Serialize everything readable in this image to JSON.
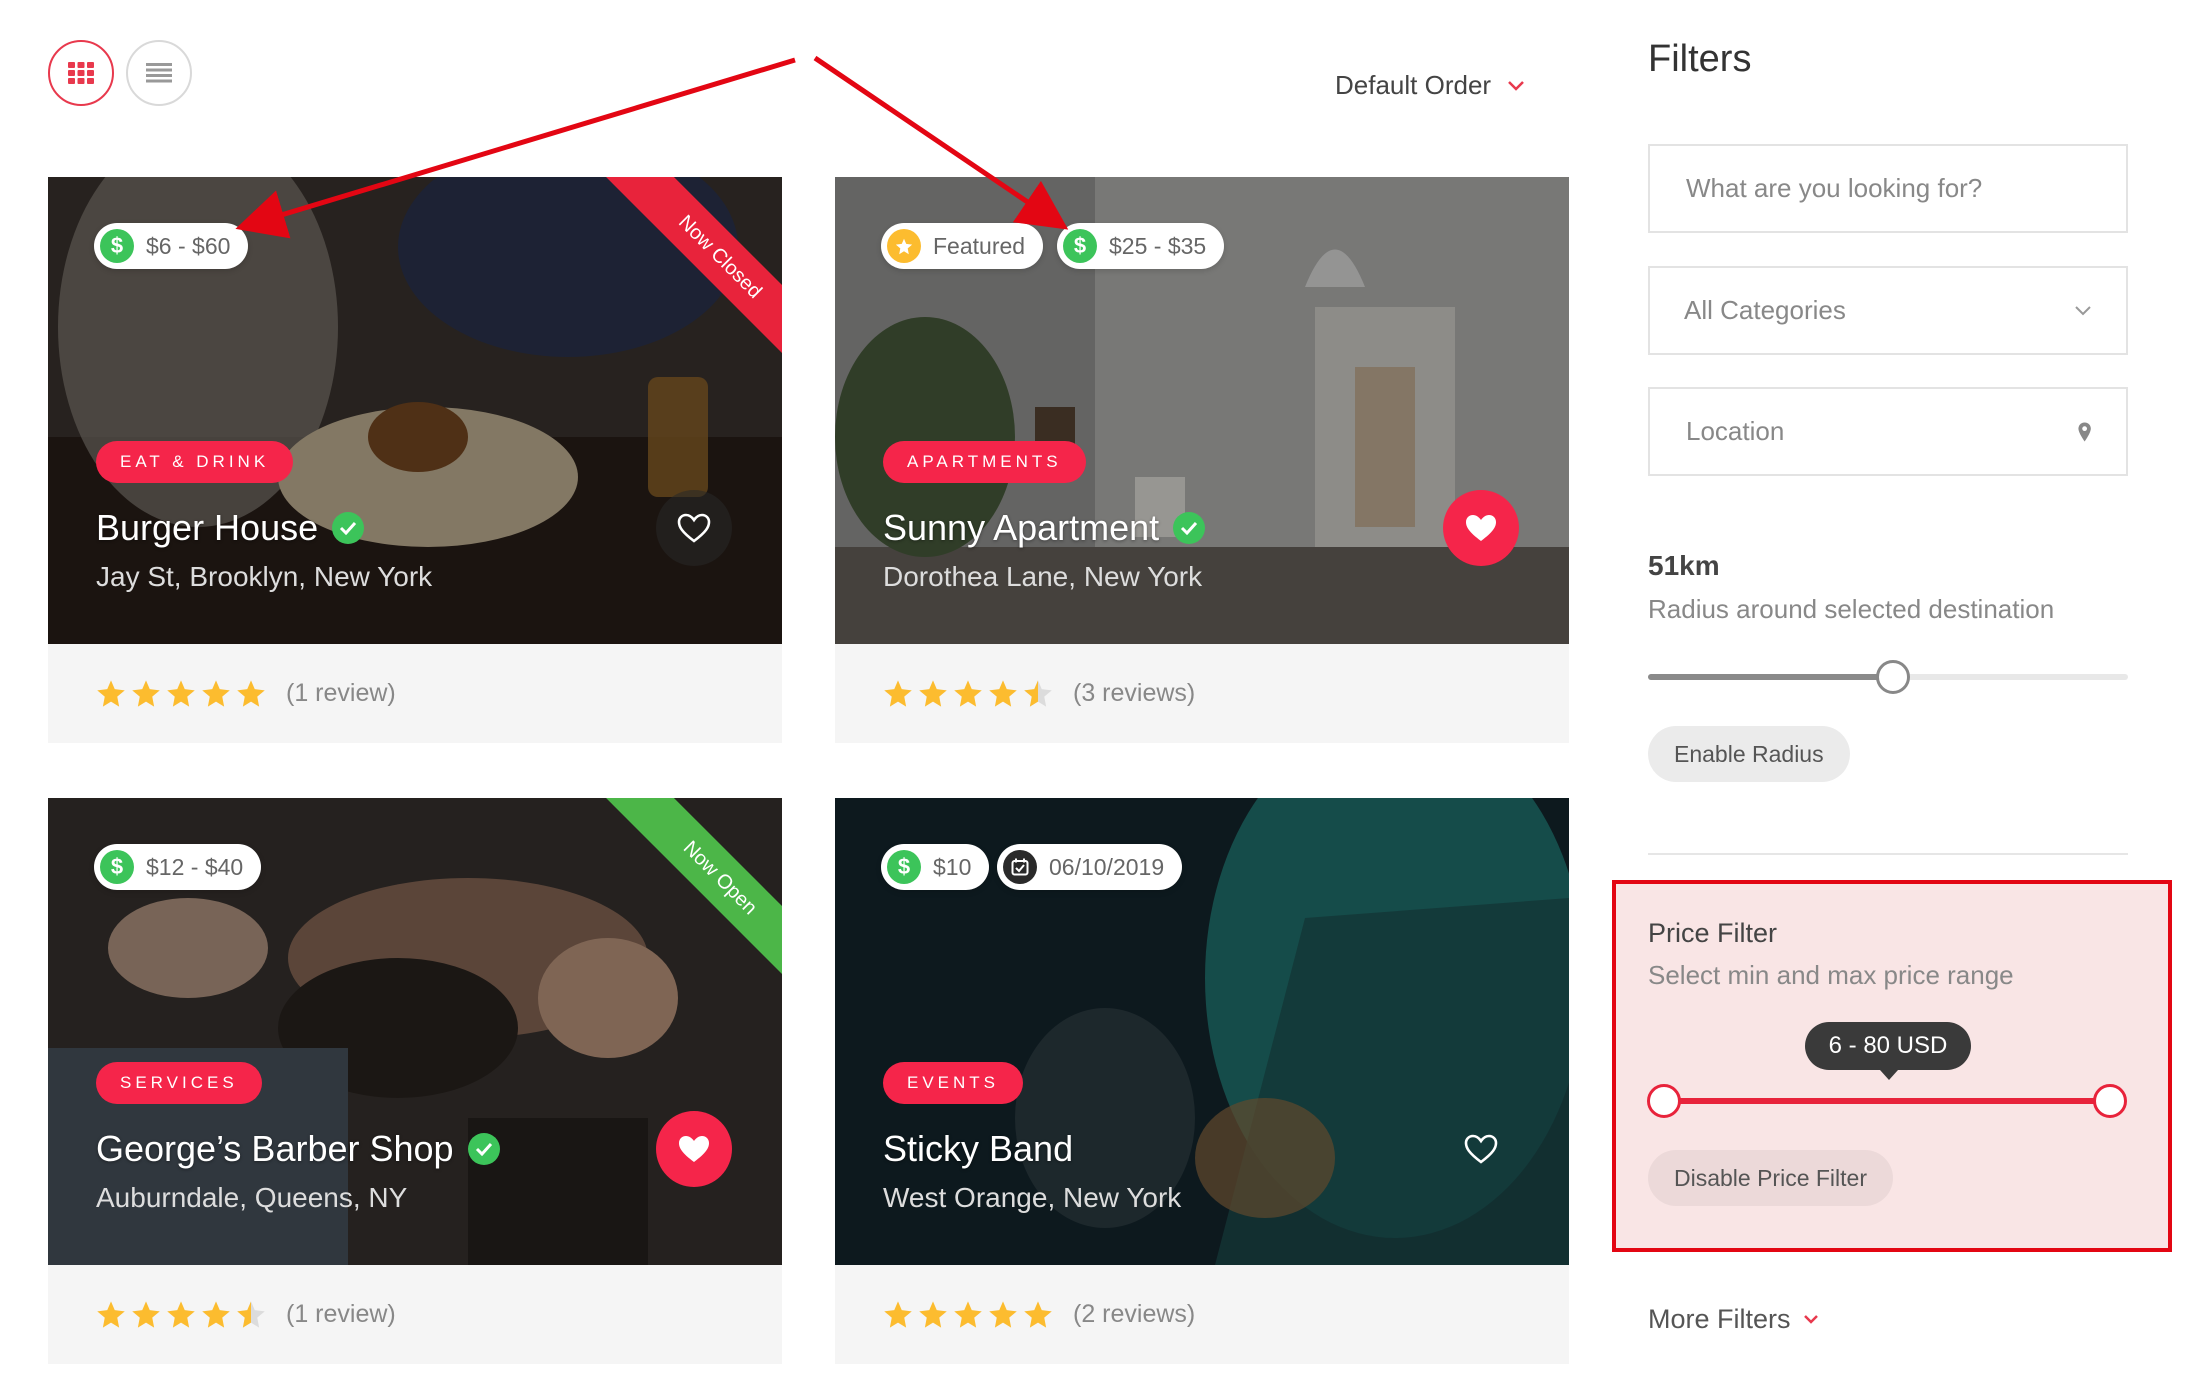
{
  "toolbar": {
    "view_grid_icon": "grid-icon",
    "view_list_icon": "list-icon",
    "sort_label": "Default Order"
  },
  "listings": [
    {
      "price": "$6 - $60",
      "category": "EAT & DRINK",
      "title": "Burger House",
      "address": "Jay St, Brooklyn, New York",
      "ribbon": "Now Closed",
      "ribbon_color": "#e8233b",
      "rating": 5,
      "reviews": "(1 review)",
      "favorite": false
    },
    {
      "featured": "Featured",
      "price": "$25 - $35",
      "category": "APARTMENTS",
      "title": "Sunny Apartment",
      "address": "Dorothea Lane, New York",
      "rating": 4.5,
      "reviews": "(3 reviews)",
      "favorite": true
    },
    {
      "price": "$12 - $40",
      "category": "SERVICES",
      "title": "George’s Barber Shop",
      "address": "Auburndale, Queens, NY",
      "ribbon": "Now Open",
      "ribbon_color": "#4cb648",
      "rating": 4.5,
      "reviews": "(1 review)",
      "favorite": true
    },
    {
      "price": "$10",
      "date": "06/10/2019",
      "category": "EVENTS",
      "title": "Sticky Band",
      "address": "West Orange, New York",
      "rating": 5,
      "reviews": "(2 reviews)",
      "favorite": false
    }
  ],
  "filters": {
    "title": "Filters",
    "search_placeholder": "What are you looking for?",
    "category_value": "All Categories",
    "location_placeholder": "Location",
    "radius_value": "51km",
    "radius_fraction": 0.51,
    "radius_desc": "Radius around selected destination",
    "enable_radius_label": "Enable Radius",
    "price_title": "Price Filter",
    "price_desc": "Select min and max price range",
    "price_range_label": "6 - 80 USD",
    "price_min": 6,
    "price_max": 80,
    "disable_price_label": "Disable Price Filter",
    "more_filters_label": "More Filters"
  },
  "colors": {
    "accent": "#f5254a",
    "star": "#fcbc2f",
    "verified": "#3cc45a",
    "annotation": "#e30613"
  }
}
